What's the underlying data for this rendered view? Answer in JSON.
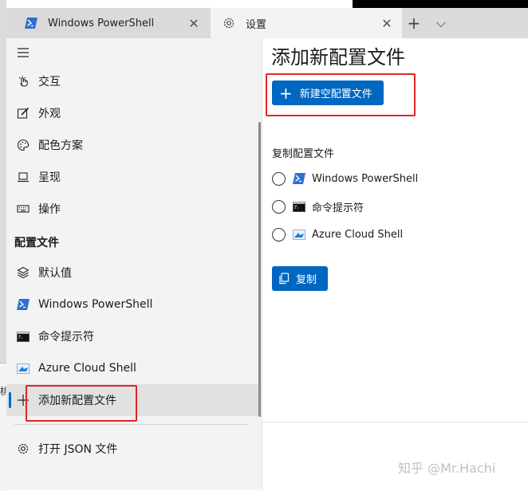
{
  "colors": {
    "accent": "#0067c0",
    "highlight": "#e52323",
    "sidebar_bg": "#f3f3f3"
  },
  "tabs": [
    {
      "label": "Windows PowerShell",
      "icon": "powershell-icon",
      "close": "✕"
    },
    {
      "label": "设置",
      "icon": "gear-icon",
      "close": "✕"
    }
  ],
  "tabbar": {
    "new_tab": "+",
    "dropdown": "⌵"
  },
  "background": {
    "left_glyph": "桃"
  },
  "sidebar": {
    "menu_icon": "hamburger-icon",
    "items": [
      {
        "label": "交互",
        "icon": "interaction-icon"
      },
      {
        "label": "外观",
        "icon": "appearance-icon"
      },
      {
        "label": "配色方案",
        "icon": "palette-icon"
      },
      {
        "label": "呈现",
        "icon": "rendering-icon"
      },
      {
        "label": "操作",
        "icon": "keyboard-icon"
      }
    ],
    "profiles_heading": "配置文件",
    "profiles": [
      {
        "label": "默认值",
        "icon": "layers-icon"
      },
      {
        "label": "Windows PowerShell",
        "icon": "powershell-icon"
      },
      {
        "label": "命令提示符",
        "icon": "cmd-icon"
      },
      {
        "label": "Azure Cloud Shell",
        "icon": "azure-icon"
      },
      {
        "label": "添加新配置文件",
        "icon": "plus-icon"
      }
    ],
    "open_json": {
      "label": "打开 JSON 文件",
      "icon": "gear-icon"
    }
  },
  "main": {
    "title": "添加新配置文件",
    "new_empty_button": "新建空配置文件",
    "copy_section_label": "复制配置文件",
    "copy_options": [
      {
        "label": "Windows PowerShell",
        "icon": "powershell-icon"
      },
      {
        "label": "命令提示符",
        "icon": "cmd-icon"
      },
      {
        "label": "Azure Cloud Shell",
        "icon": "azure-icon"
      }
    ],
    "copy_button": "复制"
  },
  "watermark": "知乎 @Mr.Hachi"
}
